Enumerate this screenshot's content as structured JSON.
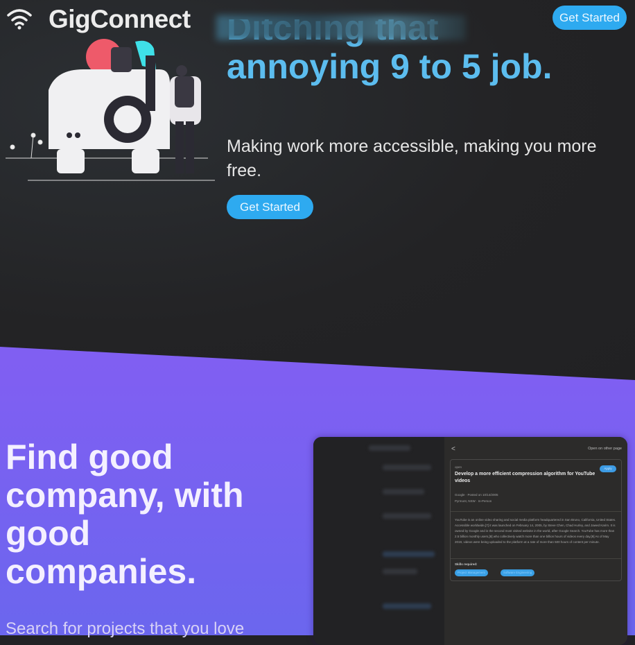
{
  "header": {
    "brand": "GigConnect",
    "logo_icon": "wifi-icon",
    "cta_label": "Get Started"
  },
  "hero": {
    "headline_line1": "Ditching that",
    "headline_line2": "annoying 9 to 5 job.",
    "subtitle": "Making work more accessible, making you more free.",
    "cta_label": "Get Started",
    "accent_color": "#5cbdef",
    "button_color": "#2eaaf0"
  },
  "features": {
    "heading": "Find good company, with good companies.",
    "subheading": "Search for projects that you love",
    "bg_color": "#8a5cf6"
  },
  "preview": {
    "back_label": "<",
    "open_other_label": "Open on other page",
    "status": "open",
    "job_title": "Develop a more efficient compression algorithm for YouTube videos",
    "apply_label": "Apply",
    "company_line": "Google · Posted on 10/14/2005",
    "location_line": "Pyrmont, NSW · In-Person",
    "description": "YouTube is an online video sharing and social media platform headquartered in San Bruno, California, United States. Accessible worldwide,[7] it was launched on February 14, 2005, by Steve Chen, Chad Hurley, and Jawed Karim. It is owned by Google and is the second most visited website in the world, after Google Search. YouTube has more than 2.5 billion monthly users,[8] who collectively watch more than one billion hours of videos every day.[9] As of May 2019, videos were being uploaded to the platform at a rate of more than 500 hours of content per minute.",
    "skills_label": "Skills required:",
    "skills": [
      "Project Management",
      "Software Engineering"
    ]
  }
}
